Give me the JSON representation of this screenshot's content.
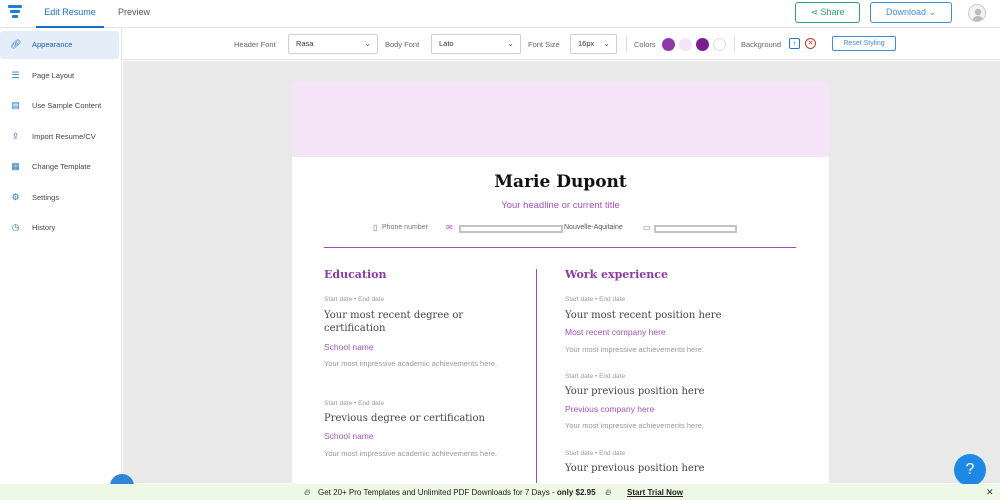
{
  "topbar": {
    "tabs": [
      {
        "label": "Edit Resume"
      },
      {
        "label": "Preview"
      }
    ],
    "share_label": "Share",
    "download_label": "Download"
  },
  "sidebar": {
    "items": [
      {
        "label": "Appearance",
        "icon": "link-icon"
      },
      {
        "label": "Page Layout",
        "icon": "list-icon"
      },
      {
        "label": "Use Sample Content",
        "icon": "document-icon"
      },
      {
        "label": "Import Resume/CV",
        "icon": "upload-icon"
      },
      {
        "label": "Change Template",
        "icon": "grid-icon"
      },
      {
        "label": "Settings",
        "icon": "gear-icon"
      },
      {
        "label": "History",
        "icon": "clock-icon"
      }
    ]
  },
  "toolbar": {
    "header_font_label": "Header Font",
    "header_font_value": "Rasa",
    "body_font_label": "Body Font",
    "body_font_value": "Lato",
    "font_size_label": "Font Size",
    "font_size_value": "16px",
    "colors_label": "Colors",
    "colors": [
      "#8e3aa6",
      "#f5e3f7",
      "#7a1f8f",
      "#ffffff"
    ],
    "background_label": "Background",
    "reset_label": "Reset Styling"
  },
  "resume": {
    "name": "Marie Dupont",
    "headline": "Your headline or current title",
    "phone": "Phone number",
    "location": "Nouvelle-Aquitaine",
    "education": {
      "title": "Education",
      "entries": [
        {
          "date": "Start date • End date",
          "title": "Your most recent degree or certification",
          "school": "School name",
          "desc": "Your most impressive academic achievements here."
        },
        {
          "date": "Start date • End date",
          "title": "Previous degree or certification",
          "school": "School name",
          "desc": "Your most impressive academic achievements here."
        }
      ]
    },
    "work": {
      "title": "Work experience",
      "entries": [
        {
          "date": "Start date • End date",
          "title": "Your most recent position here",
          "company": "Most recent company here",
          "desc": "Your most impressive achievements here."
        },
        {
          "date": "Start date • End date",
          "title": "Your previous position here",
          "company": "Previous company here",
          "desc": "Your most impressive achievements here."
        },
        {
          "date": "Start date • End date",
          "title": "Your previous position here"
        }
      ]
    }
  },
  "help_label": "?",
  "promo": {
    "text_before": "Get 20+ Pro Templates and Unlimited PDF Downloads for 7 Days - ",
    "text_bold": "only $2.95",
    "cta": "Start Trial Now",
    "close": "✕"
  }
}
